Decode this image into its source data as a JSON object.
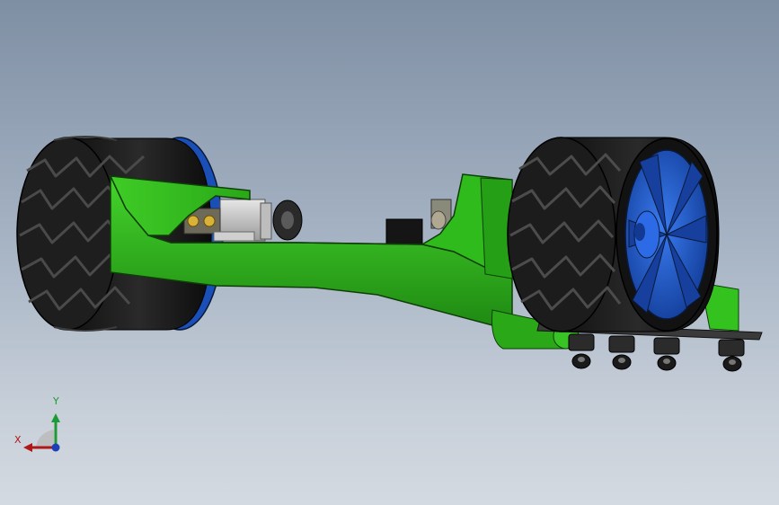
{
  "viewport": {
    "background_top": "#7f8fa3",
    "background_bottom": "#d4dae1"
  },
  "model": {
    "chassis_color": "#33c41f",
    "tire_color": "#1c1c1c",
    "hub_color": "#1e5fd8"
  },
  "triad": {
    "y_label": "Y",
    "x_label": "X",
    "y_color": "#1d9a35",
    "x_color": "#b01818",
    "z_color": "#1f3fb8"
  }
}
